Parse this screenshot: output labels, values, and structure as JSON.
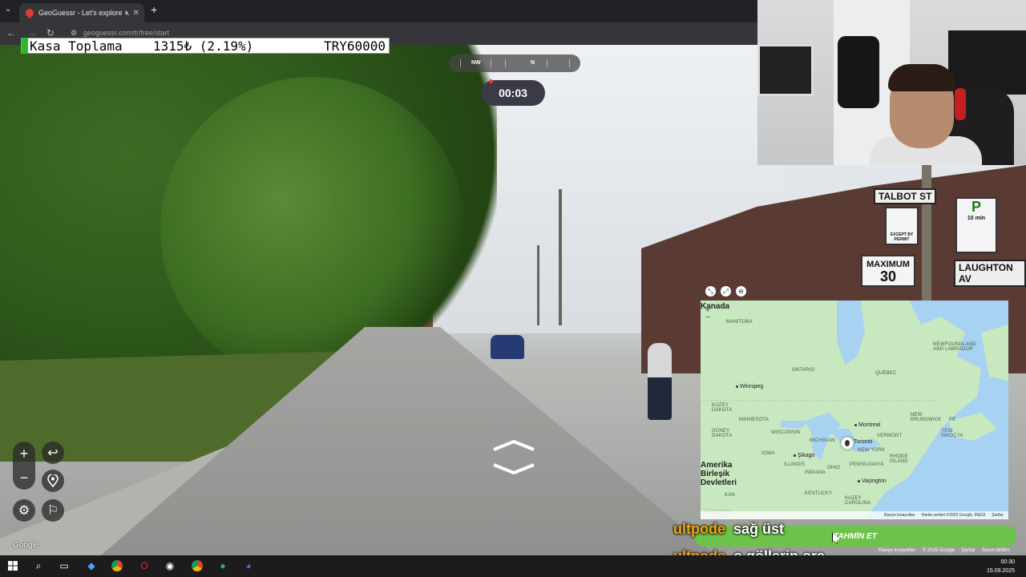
{
  "browser": {
    "tab_title": "GeoGuessr - Let's explore t",
    "url": "geoguessr.com/tr/free/start",
    "new_tab_label": "+"
  },
  "banner": {
    "label": "Kasa Toplama",
    "amount": "1315₺ (2.19%)",
    "goal": "TRY60000"
  },
  "compass": {
    "nw": "NW",
    "n": "N"
  },
  "timer": "00:03",
  "street_signs": {
    "talbot": "TALBOT ST",
    "laughton": "LAUGHTON AV",
    "maximum": "MAXIMUM",
    "speed": "30",
    "parking_p": "P",
    "parking_time": "10 min",
    "except": "EXCEPT BY PERMIT"
  },
  "minimap": {
    "country_top": "Kanada",
    "labels": {
      "manitoba": "MANITOBA",
      "ontario": "ONTARIO",
      "quebec": "QUÉBEC",
      "newfoundland": "NEWFOUNDLAND\nAND LABRADOR",
      "kuzey_dakota": "KUZEY\nDAKOTA",
      "minnesota": "MINNESOTA",
      "guney_dakota": "GÜNEY\nDAKOTA",
      "wisconsin": "WISCONSIN",
      "michigan": "MICHIGAN",
      "iowa": "IOWA",
      "illinois": "ILLINOIS",
      "indiana": "INDIANA",
      "ohio": "OHIO",
      "pensilvanya": "PENSİLVANYA",
      "new_york": "NEW YORK",
      "vermont": "VERMONT",
      "new_brunswick": "NEW\nBRUNSWICK",
      "pe": "PE",
      "nova_scotia": "YENİ\nİSKOÇYA",
      "rhode_island": "RHODE\nISLAND",
      "kentucky": "KENTUCKY",
      "kuzey_carolina": "KUZEY\nCAROLINA",
      "kansas": "KAN"
    },
    "cities": {
      "winnipeg": "Winnipeg",
      "montreal": "Montreal",
      "toronto": "Toronto",
      "chicago": "Şikago",
      "washington": "Vaşington"
    },
    "country_us": "Amerika\nBirleşik\nDevletleri",
    "footer": [
      "Klavye kısayolları",
      "Harita verileri ©2025 Google, INEGI",
      "Şartlar"
    ],
    "google": "Google",
    "zoom_in": "+",
    "zoom_out": "−"
  },
  "guess_button": "TAHMİN ET",
  "sv_footer": [
    "Klavye kısayolları",
    "© 2025 Google",
    "Şartlar",
    "Sorun bildirin"
  ],
  "google_watermark": "Google",
  "chat": [
    {
      "user": "ultpode",
      "message": "sağ üst"
    },
    {
      "user": "ultpode",
      "message": "o göllerin ora"
    }
  ],
  "clock": {
    "time": "00:30",
    "date": "15.09.2025"
  },
  "colors": {
    "guess_green": "#6cc24a",
    "chat_user": "#f0a21a",
    "banner_mark": "#2eb82e"
  }
}
